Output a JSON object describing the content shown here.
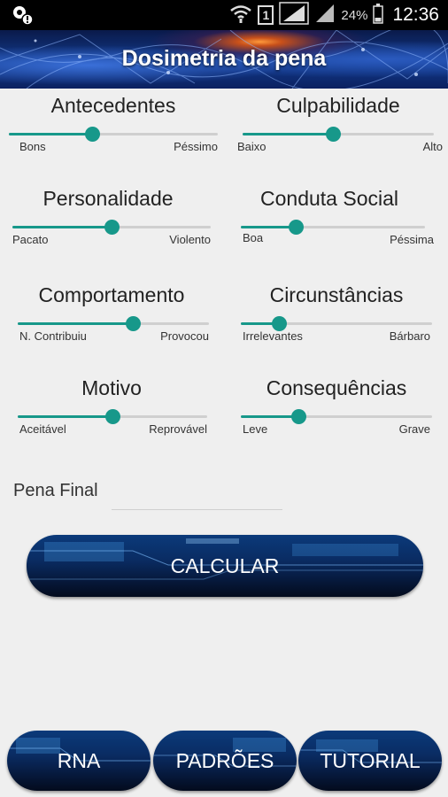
{
  "status_bar": {
    "battery_percent": "24%",
    "sim_label": "1",
    "time": "12:36",
    "icons": [
      "notification-settings-icon",
      "wifi-icon",
      "sim-icon",
      "signal-icon",
      "signal-icon",
      "battery-icon"
    ]
  },
  "header": {
    "title": "Dosimetria da pena"
  },
  "sliders": [
    {
      "id": "antecedentes",
      "title": "Antecedentes",
      "min_label": "Bons",
      "max_label": "Péssimo",
      "level": 0.4
    },
    {
      "id": "culpabilidade",
      "title": "Culpabilidade",
      "min_label": "Baixo",
      "max_label": "Alto",
      "level": 0.47
    },
    {
      "id": "personalidade",
      "title": "Personalidade",
      "min_label": "Pacato",
      "max_label": "Violento",
      "level": 0.5
    },
    {
      "id": "conduta-social",
      "title": "Conduta Social",
      "min_label": "Boa",
      "max_label": "Péssima",
      "level": 0.3
    },
    {
      "id": "comportamento",
      "title": "Comportamento",
      "min_label": "N. Contribuiu",
      "max_label": "Provocou",
      "level": 0.6
    },
    {
      "id": "circunstancias",
      "title": "Circunstâncias",
      "min_label": "Irrelevantes",
      "max_label": "Bárbaro",
      "level": 0.2
    },
    {
      "id": "motivo",
      "title": "Motivo",
      "min_label": "Aceitável",
      "max_label": "Reprovável",
      "level": 0.5
    },
    {
      "id": "consequencias",
      "title": "Consequências",
      "min_label": "Leve",
      "max_label": "Grave",
      "level": 0.3
    }
  ],
  "pena_final": {
    "label": "Pena Final",
    "value": ""
  },
  "buttons": {
    "calcular": "CALCULAR",
    "rna": "RNA",
    "padroes": "PADRÕES",
    "tutorial": "TUTORIAL"
  },
  "colors": {
    "accent": "#17988a",
    "background": "#efefef",
    "track": "#cfcfcf"
  }
}
